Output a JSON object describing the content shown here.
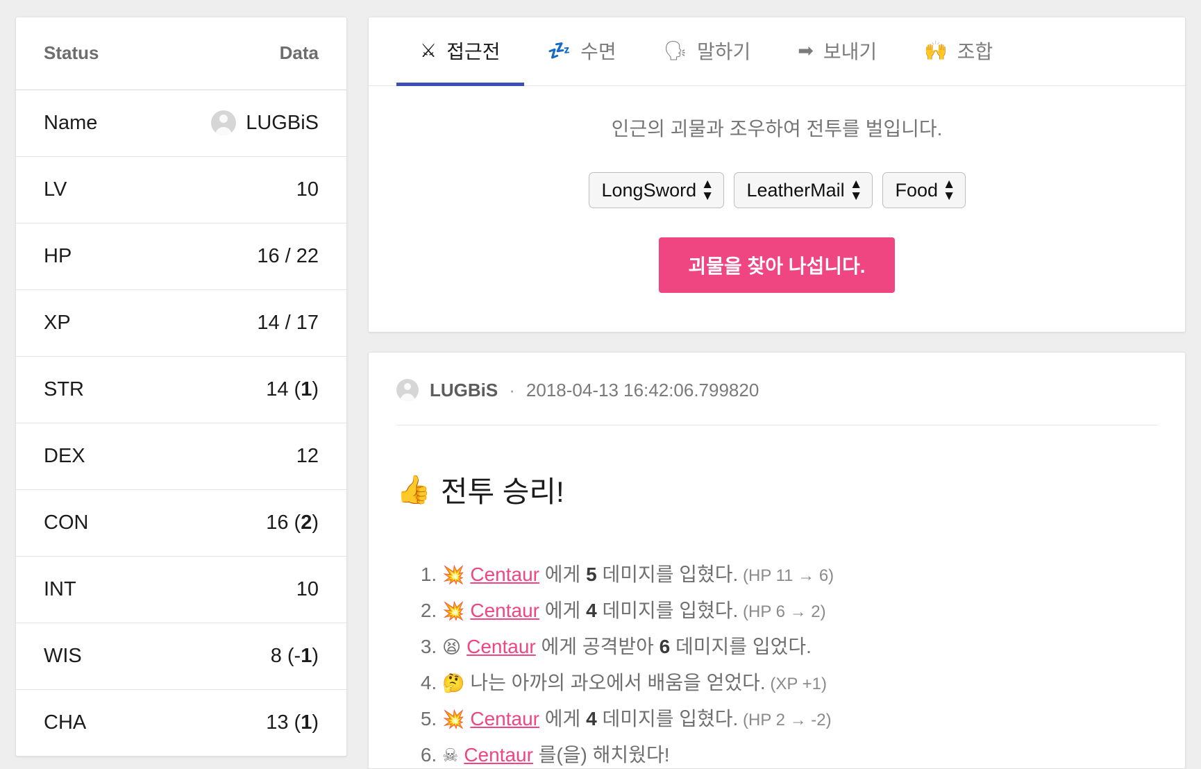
{
  "status_panel": {
    "columns": {
      "key": "Status",
      "value": "Data"
    },
    "rows": [
      {
        "label": "Name",
        "value": "LUGBiS",
        "avatar": true
      },
      {
        "label": "LV",
        "value": "10"
      },
      {
        "label": "HP",
        "value": "16 / 22"
      },
      {
        "label": "XP",
        "value": "14 / 17"
      },
      {
        "label": "STR",
        "value": "14 (",
        "bonus": "1",
        "suffix": ")"
      },
      {
        "label": "DEX",
        "value": "12"
      },
      {
        "label": "CON",
        "value": "16 (",
        "bonus": "2",
        "suffix": ")"
      },
      {
        "label": "INT",
        "value": "10"
      },
      {
        "label": "WIS",
        "value": "8 (-",
        "bonus": "1",
        "suffix": ")"
      },
      {
        "label": "CHA",
        "value": "13 (",
        "bonus": "1",
        "suffix": ")"
      }
    ]
  },
  "action_panel": {
    "tabs": [
      {
        "label": "접근전",
        "icon": "⚔",
        "icon_name": "crossed-swords-icon",
        "active": true
      },
      {
        "label": "수면",
        "icon": "💤",
        "icon_name": "sleep-zzz-icon",
        "active": false
      },
      {
        "label": "말하기",
        "icon": "🗣",
        "icon_name": "speaking-head-icon",
        "active": false
      },
      {
        "label": "보내기",
        "icon": "➡",
        "icon_name": "right-arrow-icon",
        "active": false
      },
      {
        "label": "조합",
        "icon": "🙌",
        "icon_name": "raised-hands-icon",
        "active": false
      }
    ],
    "description": "인근의 괴물과 조우하여 전투를 벌입니다.",
    "selects": [
      {
        "name": "weapon-select",
        "value": "LongSword"
      },
      {
        "name": "armor-select",
        "value": "LeatherMail"
      },
      {
        "name": "item-select",
        "value": "Food"
      }
    ],
    "submit_label": "괴물을 찾아 나섭니다.",
    "accent_color": "#ef4581",
    "active_tab_underline_color": "#3b4fb5"
  },
  "log_panel": {
    "author": "LUGBiS",
    "separator": "·",
    "timestamp": "2018-04-13 16:42:06.799820",
    "title_icon": "👍",
    "title": "전투 승리!",
    "entries": [
      {
        "icon": "💥",
        "icon_name": "explosion-icon",
        "target": "Centaur",
        "mid": " 에게 ",
        "amount": "5",
        "tail": " 데미지를 입혔다.",
        "note": "(HP 11 → 6)"
      },
      {
        "icon": "💥",
        "icon_name": "explosion-icon",
        "target": "Centaur",
        "mid": " 에게 ",
        "amount": "4",
        "tail": " 데미지를 입혔다.",
        "note": "(HP 6 → 2)"
      },
      {
        "icon": "😫",
        "icon_name": "tired-face-icon",
        "target": "Centaur",
        "mid": " 에게 공격받아 ",
        "amount": "6",
        "tail": " 데미지를 입었다.",
        "note": ""
      },
      {
        "icon": "🤔",
        "icon_name": "thinking-face-icon",
        "target": "",
        "mid": "나는 아까의 과오에서 배움을 얻었다.",
        "amount": "",
        "tail": "",
        "note": "(XP +1)"
      },
      {
        "icon": "💥",
        "icon_name": "explosion-icon",
        "target": "Centaur",
        "mid": " 에게 ",
        "amount": "4",
        "tail": " 데미지를 입혔다.",
        "note": "(HP 2 → -2)"
      },
      {
        "icon": "☠",
        "icon_name": "skull-crossbones-icon",
        "target": "Centaur",
        "mid": " 를(을) 해치웠다!",
        "amount": "",
        "tail": "",
        "note": ""
      }
    ]
  }
}
